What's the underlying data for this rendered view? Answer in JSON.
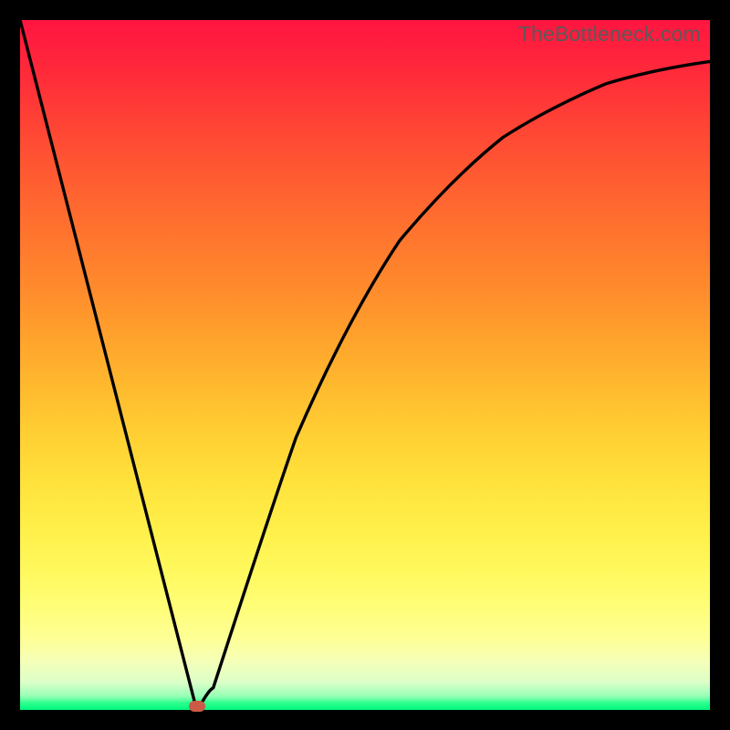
{
  "watermark": "TheBottleneck.com",
  "chart_data": {
    "type": "line",
    "title": "",
    "xlabel": "",
    "ylabel": "",
    "x": [
      0.0,
      0.05,
      0.1,
      0.15,
      0.2,
      0.24,
      0.256,
      0.28,
      0.32,
      0.36,
      0.4,
      0.45,
      0.5,
      0.55,
      0.6,
      0.65,
      0.7,
      0.75,
      0.8,
      0.85,
      0.9,
      0.95,
      1.0
    ],
    "y": [
      1.0,
      0.805,
      0.61,
      0.415,
      0.22,
      0.063,
      0.0,
      0.032,
      0.155,
      0.28,
      0.395,
      0.51,
      0.605,
      0.68,
      0.74,
      0.79,
      0.83,
      0.862,
      0.887,
      0.908,
      0.923,
      0.933,
      0.94
    ],
    "xlim": [
      0,
      1
    ],
    "ylim": [
      0,
      1
    ],
    "marker": {
      "x": 0.256,
      "y": 0.0
    },
    "grid": false,
    "legend": false
  }
}
